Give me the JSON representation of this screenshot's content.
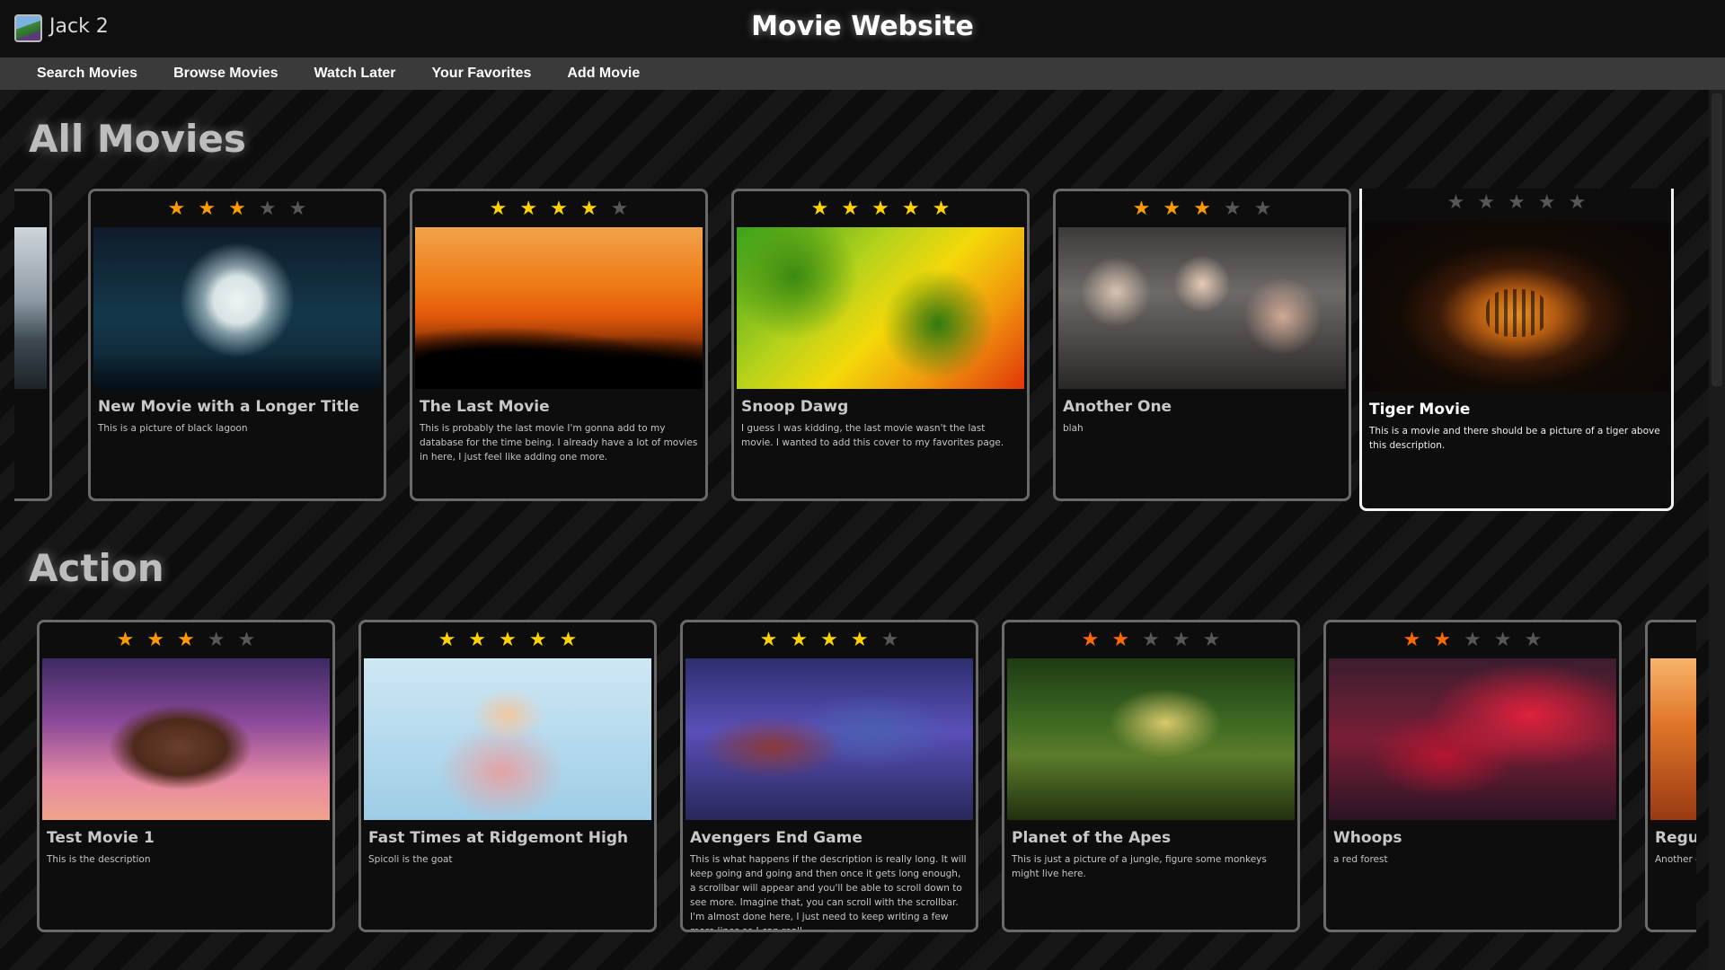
{
  "window": {
    "app_name": "Jack 2"
  },
  "header": {
    "title": "Movie Website"
  },
  "nav": {
    "items": [
      {
        "label": "Search Movies"
      },
      {
        "label": "Browse Movies"
      },
      {
        "label": "Watch Later"
      },
      {
        "label": "Your Favorites"
      },
      {
        "label": "Add Movie"
      }
    ]
  },
  "colors": {
    "star_orange": "#ff9a00",
    "star_yellow": "#ffd200",
    "star_red": "#ff6a00",
    "star_empty": "#575757",
    "selected_border": "#f2f2f2"
  },
  "sections": [
    {
      "title": "All Movies",
      "movies": [
        {
          "title": "",
          "description": "",
          "rating": 0,
          "star_color": "orange",
          "art": "mountains-icon",
          "partial": true
        },
        {
          "title": "New Movie with a Longer Title",
          "description": "This is a picture of black lagoon",
          "rating": 3,
          "star_color": "orange",
          "art": "moon-girl-icon"
        },
        {
          "title": "The Last Movie",
          "description": "This is probably the last movie I'm gonna add to my database for the time being. I already have a lot of movies in here, I just feel like adding one more.",
          "rating": 4,
          "star_color": "yellow",
          "art": "sunset-couple-icon"
        },
        {
          "title": "Snoop Dawg",
          "description": "I guess I was kidding, the last movie wasn't the last movie. I wanted to add this cover to my favorites page.",
          "rating": 5,
          "star_color": "yellow",
          "art": "leaves-icon"
        },
        {
          "title": "Another One",
          "description": "blah",
          "rating": 3,
          "star_color": "orange",
          "art": "party-crowd-icon"
        },
        {
          "title": "Tiger Movie",
          "description": "This is a movie and there should be a picture of a tiger above this description.",
          "rating": 0,
          "star_color": "orange",
          "art": "tiger-icon",
          "selected": true
        }
      ]
    },
    {
      "title": "Action",
      "movies": [
        {
          "title": "Test Movie 1",
          "description": "This is the description",
          "rating": 3,
          "star_color": "orange",
          "art": "portrait-icon"
        },
        {
          "title": "Fast Times at Ridgemont High",
          "description": "Spicoli is the goat",
          "rating": 5,
          "star_color": "yellow",
          "art": "fast-times-poster-icon"
        },
        {
          "title": "Avengers End Game",
          "description": "This is what happens if the description is really long. It will keep going and going and then once it gets long enough, a scrollbar will appear and you'll be able to scroll down to see more. Imagine that, you can scroll with the scrollbar. I'm almost done here, I just need to keep writing a few more lines so I can reall...",
          "rating": 4,
          "star_color": "yellow",
          "art": "avengers-poster-icon"
        },
        {
          "title": "Planet of the Apes",
          "description": "This is just a picture of a jungle, figure some monkeys might live here.",
          "rating": 2,
          "star_color": "red",
          "art": "jungle-icon"
        },
        {
          "title": "Whoops",
          "description": "a red forest",
          "rating": 2,
          "star_color": "red",
          "art": "red-forest-icon"
        },
        {
          "title": "Regul",
          "description": "Another g going to b",
          "rating": 0,
          "star_color": "orange",
          "art": "autumn-icon",
          "partial": true
        }
      ]
    }
  ]
}
